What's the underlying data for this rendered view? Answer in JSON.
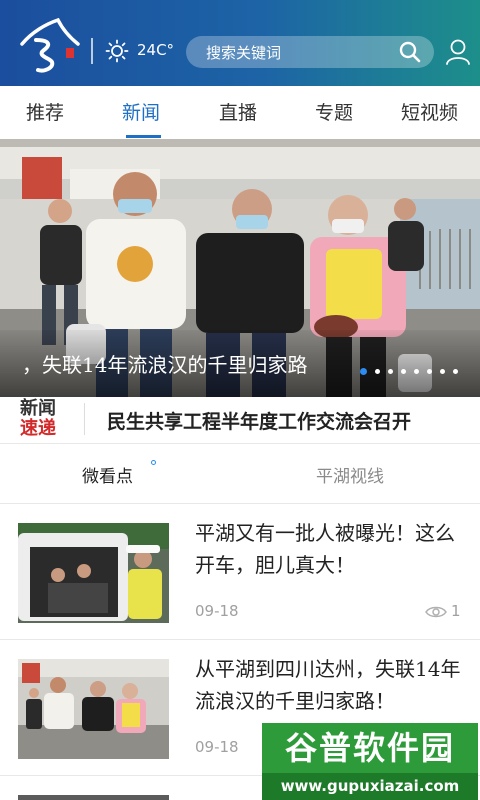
{
  "header": {
    "temperature": "24C°",
    "search_placeholder": "搜索关键词",
    "colors": {
      "gradient_start": "#1b4e9e",
      "gradient_end": "#1d8f8a"
    },
    "icons": [
      "logo",
      "sun-icon",
      "search-icon",
      "user-icon"
    ]
  },
  "tabs": [
    {
      "label": "推荐",
      "active": false
    },
    {
      "label": "新闻",
      "active": true
    },
    {
      "label": "直播",
      "active": false
    },
    {
      "label": "专题",
      "active": false
    },
    {
      "label": "短视频",
      "active": false
    }
  ],
  "banner": {
    "caption": "，失联14年流浪汉的千里归家路",
    "slide_count": 8,
    "active_slide": 1
  },
  "flash_news": {
    "label_line1": "新闻",
    "label_line2": "速递",
    "headline": "民生共享工程半年度工作交流会召开"
  },
  "subtabs": [
    {
      "label": "微看点",
      "active": true
    },
    {
      "label": "平湖视线",
      "active": false
    }
  ],
  "news_list": [
    {
      "title": "平湖又有一批人被曝光！这么开车，胆儿真大！",
      "date": "09-18",
      "views": "1"
    },
    {
      "title": "从平湖到四川达州，失联14年流浪汉的千里归家路！",
      "date": "09-18",
      "views": ""
    }
  ],
  "watermark": {
    "title": "谷普软件园",
    "url": "www.gupuxiazai.com"
  },
  "accent_color": "#1f6fc5"
}
